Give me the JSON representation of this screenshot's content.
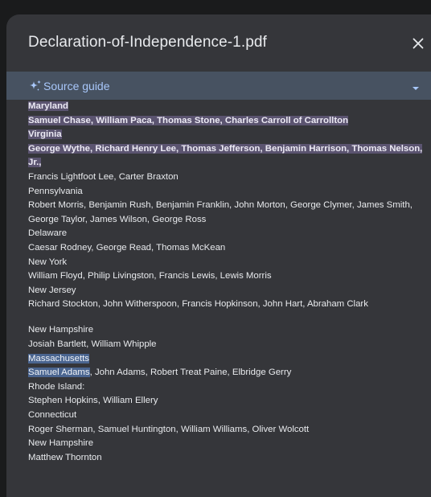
{
  "header": {
    "title": "Declaration-of-Independence-1.pdf",
    "close_icon": "close-icon"
  },
  "guide": {
    "label": "Source guide",
    "icon": "sparkle-icon",
    "expand_icon": "caret-down-icon"
  },
  "content": {
    "lines": [
      "Maryland",
      "Samuel Chase, William Paca, Thomas Stone, Charles Carroll of Carrollton",
      "Virginia",
      "George Wythe, Richard Henry Lee, Thomas Jefferson, Benjamin Harrison, Thomas Nelson, Jr.,",
      "Francis Lightfoot Lee, Carter Braxton",
      "Pennsylvania",
      "Robert Morris, Benjamin Rush, Benjamin Franklin, John Morton, George Clymer, James Smith,",
      "George Taylor, James Wilson, George Ross",
      "Delaware",
      "Caesar Rodney, George Read, Thomas McKean",
      "New York",
      "William Floyd, Philip Livingston, Francis Lewis, Lewis Morris",
      "New Jersey",
      "Richard Stockton, John Witherspoon, Francis Hopkinson, John Hart, Abraham Clark",
      "New Hampshire",
      "Josiah Bartlett, William Whipple",
      "Massachusetts",
      "Samuel Adams",
      ", John Adams, Robert Treat Paine, Elbridge Gerry",
      "Rhode Island:",
      "Stephen Hopkins, William Ellery",
      "Connecticut",
      "Roger Sherman, Samuel Huntington, William Williams, Oliver Wolcott",
      "New Hampshire",
      "Matthew Thornton"
    ]
  },
  "colors": {
    "panel_bg": "#35363a",
    "guide_bar_bg": "#475261",
    "accent": "#a8c7fa",
    "highlight_purple": "#5b5470",
    "highlight_blue": "#4a6590"
  }
}
